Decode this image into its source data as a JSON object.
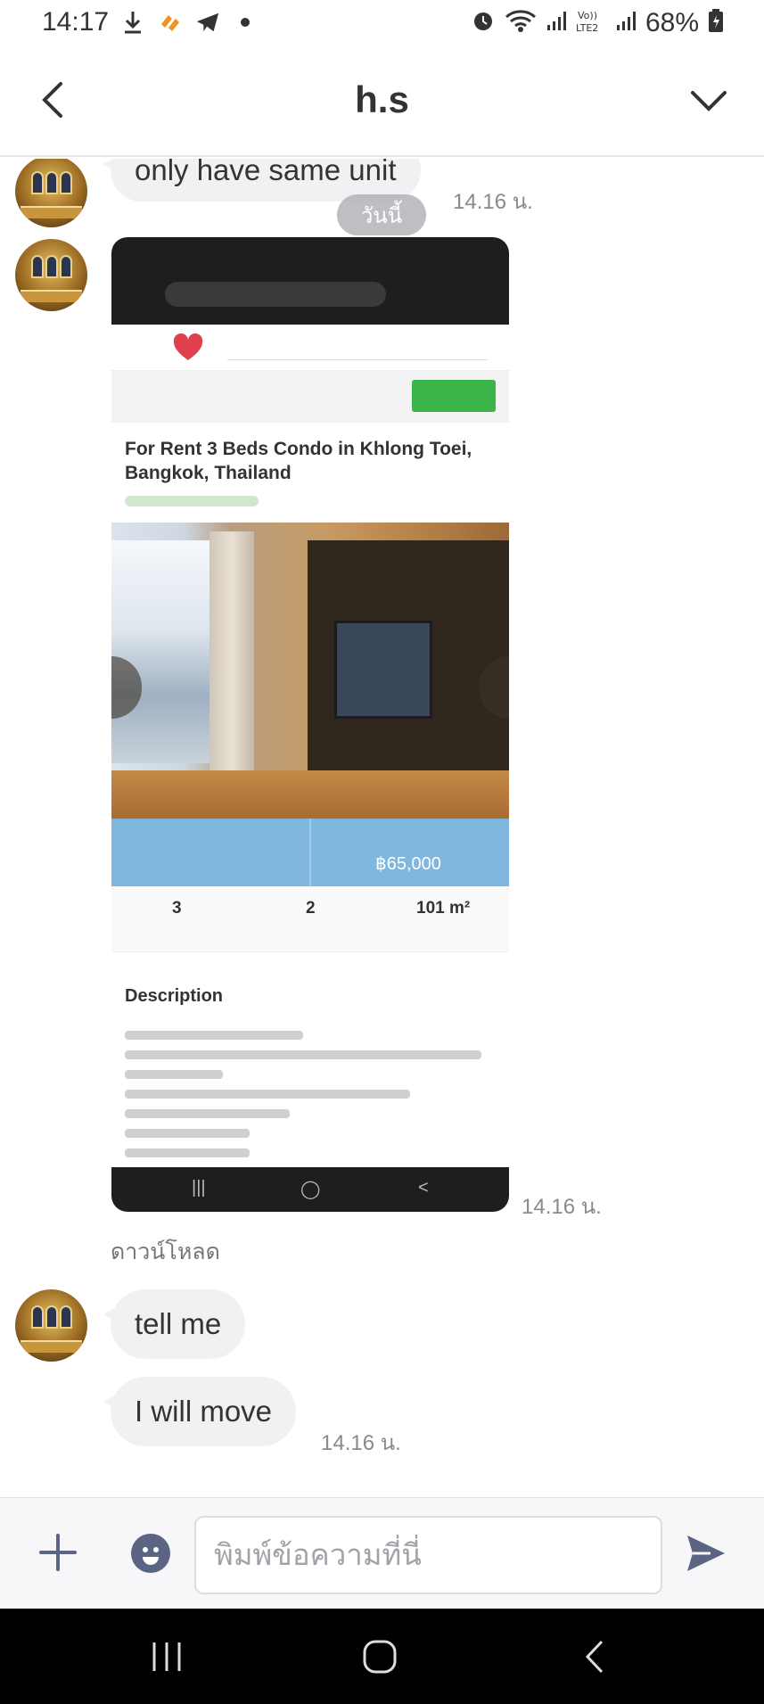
{
  "status_bar": {
    "time": "14:17",
    "battery": "68%",
    "icons_left": [
      "download-icon",
      "app-notification-icon",
      "telegram-icon",
      "dot-icon"
    ],
    "icons_right": [
      "alarm-icon",
      "wifi-icon",
      "signal-icon",
      "volte-icon",
      "signal-icon",
      "battery-icon"
    ]
  },
  "header": {
    "title": "h.s"
  },
  "chat": {
    "messages": [
      {
        "text": "only have same unit",
        "time": "14.16 น."
      },
      {
        "date_chip": "วันนี้"
      },
      {
        "type": "image",
        "time": "14.16 น.",
        "download_label": "ดาวน์โหลด",
        "image": {
          "title": "For Rent 3 Beds Condo in Khlong Toei, Bangkok, Thailand",
          "price": "฿65,000",
          "stats": [
            "3",
            "2",
            "101 m²"
          ],
          "description_heading": "Description"
        }
      },
      {
        "text": "tell me"
      },
      {
        "text": "I will move",
        "time": "14.16 น."
      }
    ]
  },
  "input_bar": {
    "placeholder": "พิมพ์ข้อความที่นี่"
  },
  "colors": {
    "bubble": "#f1f1f3",
    "accent_send": "#5b6482",
    "chip": "#aaaaaf"
  }
}
